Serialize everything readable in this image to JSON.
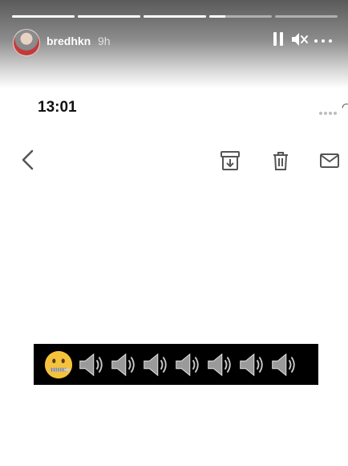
{
  "story": {
    "username": "bredhkn",
    "time_ago": "9h",
    "progress": [
      1,
      1,
      1,
      0.25,
      0
    ]
  },
  "screenshot": {
    "status_time": "13:01"
  },
  "banner": {
    "emoji_sequence": [
      "zipper-mouth-face",
      "speaker-high-volume",
      "speaker-high-volume",
      "speaker-high-volume",
      "speaker-high-volume",
      "speaker-high-volume",
      "speaker-high-volume",
      "speaker-high-volume"
    ]
  },
  "colors": {
    "banner_bg": "#000000",
    "emoji_yellow": "#f5c33b"
  }
}
